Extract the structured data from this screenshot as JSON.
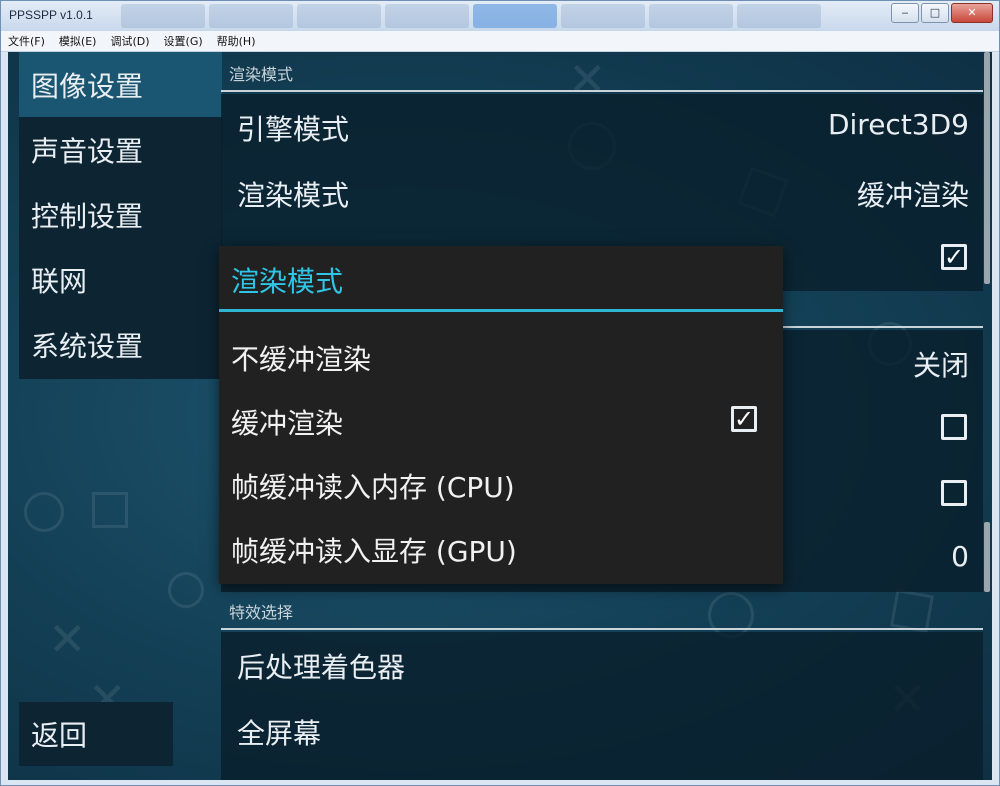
{
  "window": {
    "title": "PPSSPP v1.0.1",
    "buttons": {
      "minimize": "‒",
      "maximize": "□",
      "close": "✕"
    }
  },
  "menubar": [
    "文件(F)",
    "模拟(E)",
    "调试(D)",
    "设置(G)",
    "帮助(H)"
  ],
  "sidebar": {
    "items": [
      {
        "label": "图像设置",
        "active": true
      },
      {
        "label": "声音设置",
        "active": false
      },
      {
        "label": "控制设置",
        "active": false
      },
      {
        "label": "联网",
        "active": false
      },
      {
        "label": "系统设置",
        "active": false
      }
    ],
    "back_label": "返回"
  },
  "sections": {
    "render_header": "渲染模式",
    "effects_header": "特效选择"
  },
  "settings": {
    "engine_label": "引擎模式",
    "engine_value": "Direct3D9",
    "render_label": "渲染模式",
    "render_value": "缓冲渲染",
    "hidden_row_checked": true,
    "row_off_value": "关闭",
    "row_checkbox_a": false,
    "row_checkbox_b": false,
    "row_number_value": "0",
    "postprocess_label": "后处理着色器",
    "fullscreen_label": "全屏幕"
  },
  "dialog": {
    "title": "渲染模式",
    "options": [
      {
        "label": "不缓冲渲染",
        "checked": false
      },
      {
        "label": "缓冲渲染",
        "checked": true
      },
      {
        "label": "帧缓冲读入内存 (CPU)",
        "checked": false
      },
      {
        "label": "帧缓冲读入显存 (GPU)",
        "checked": false
      }
    ]
  },
  "colors": {
    "accent": "#2fc5e6",
    "active_sidebar": "#1a5672",
    "background": "#133f55"
  }
}
